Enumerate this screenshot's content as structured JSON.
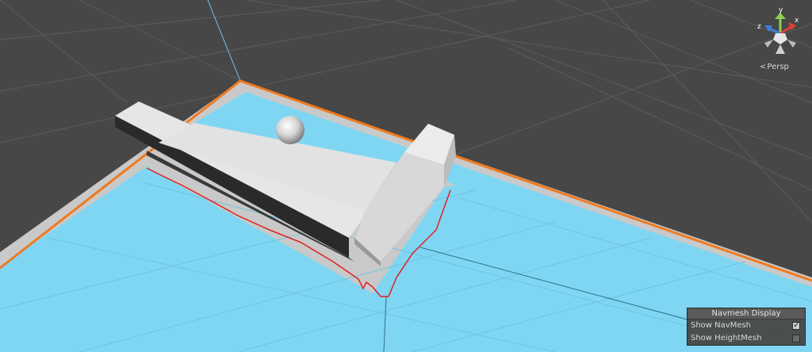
{
  "gizmo": {
    "axis_y": "y",
    "axis_x": "x",
    "axis_z": "z",
    "colors": {
      "x": "#e0413a",
      "y": "#8fd14f",
      "z": "#3f7fe0"
    }
  },
  "projection": {
    "label": "Persp",
    "icon": "back-chevron-icon"
  },
  "navmesh_panel": {
    "title": "Navmesh Display",
    "options": [
      {
        "label": "Show NavMesh",
        "checked": true
      },
      {
        "label": "Show HeightMesh",
        "checked": false
      }
    ]
  },
  "scene": {
    "selection_outline_color": "#f07a1e",
    "navmesh_color": "#7fd6f2",
    "navmesh_edge_color": "#e02020",
    "background_color": "#474747",
    "grid_color": "#5a5a5a"
  }
}
